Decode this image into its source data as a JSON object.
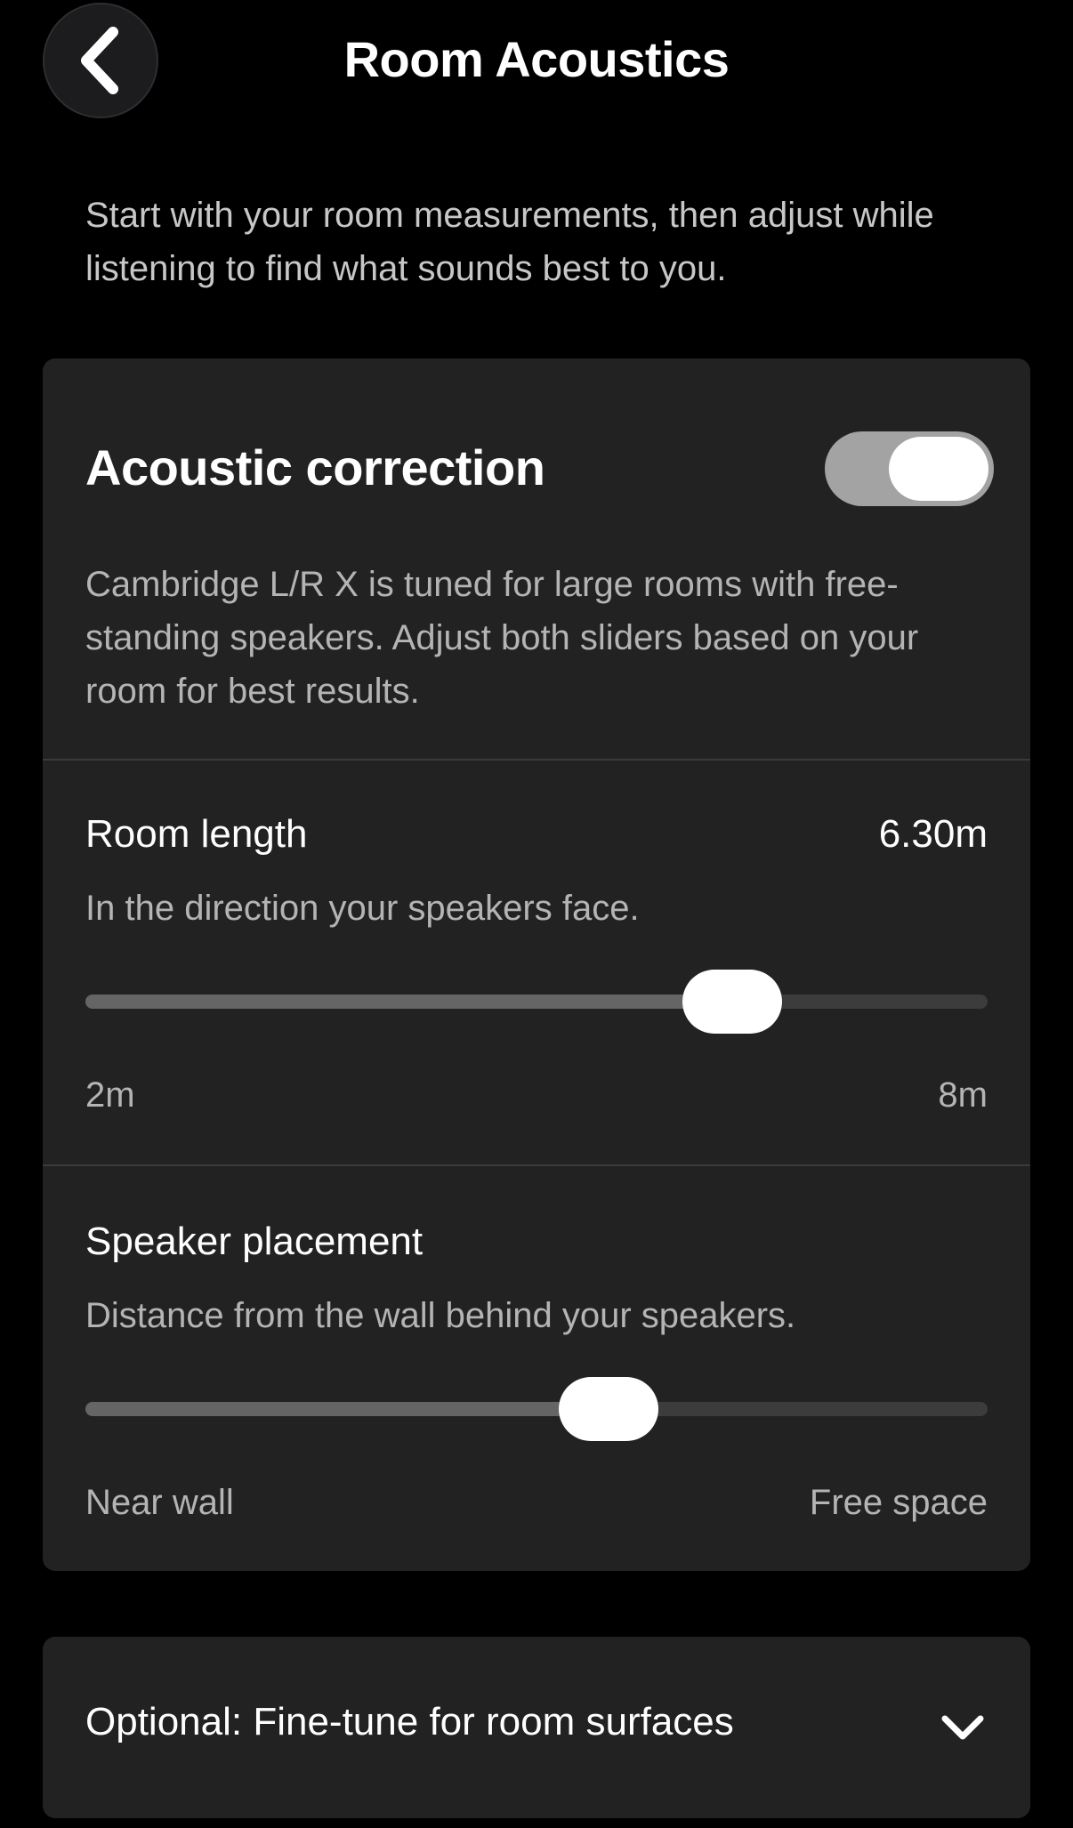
{
  "header": {
    "title": "Room Acoustics",
    "back_icon": "chevron-left-icon"
  },
  "intro": "Start with your room measurements, then adjust while listening to find what sounds best to you.",
  "acoustic_correction": {
    "title": "Acoustic correction",
    "toggle_on": true,
    "description": "Cambridge L/R X is tuned for large rooms with free-standing speakers. Adjust both sliders based on your room for best results."
  },
  "room_length": {
    "label": "Room length",
    "value_text": "6.30m",
    "help": "In the direction your speakers face.",
    "min_label": "2m",
    "max_label": "8m",
    "min": 2,
    "max": 8,
    "value": 6.3
  },
  "speaker_placement": {
    "label": "Speaker placement",
    "help": "Distance from the wall behind your speakers.",
    "min_label": "Near wall",
    "max_label": "Free space",
    "fraction": 0.58
  },
  "optional": {
    "label": "Optional: Fine-tune for room surfaces",
    "icon": "chevron-down-icon"
  },
  "colors": {
    "background": "#000000",
    "card": "#222222",
    "toggle_track": "#a3a3a3",
    "text_secondary": "#b4b4b4"
  }
}
